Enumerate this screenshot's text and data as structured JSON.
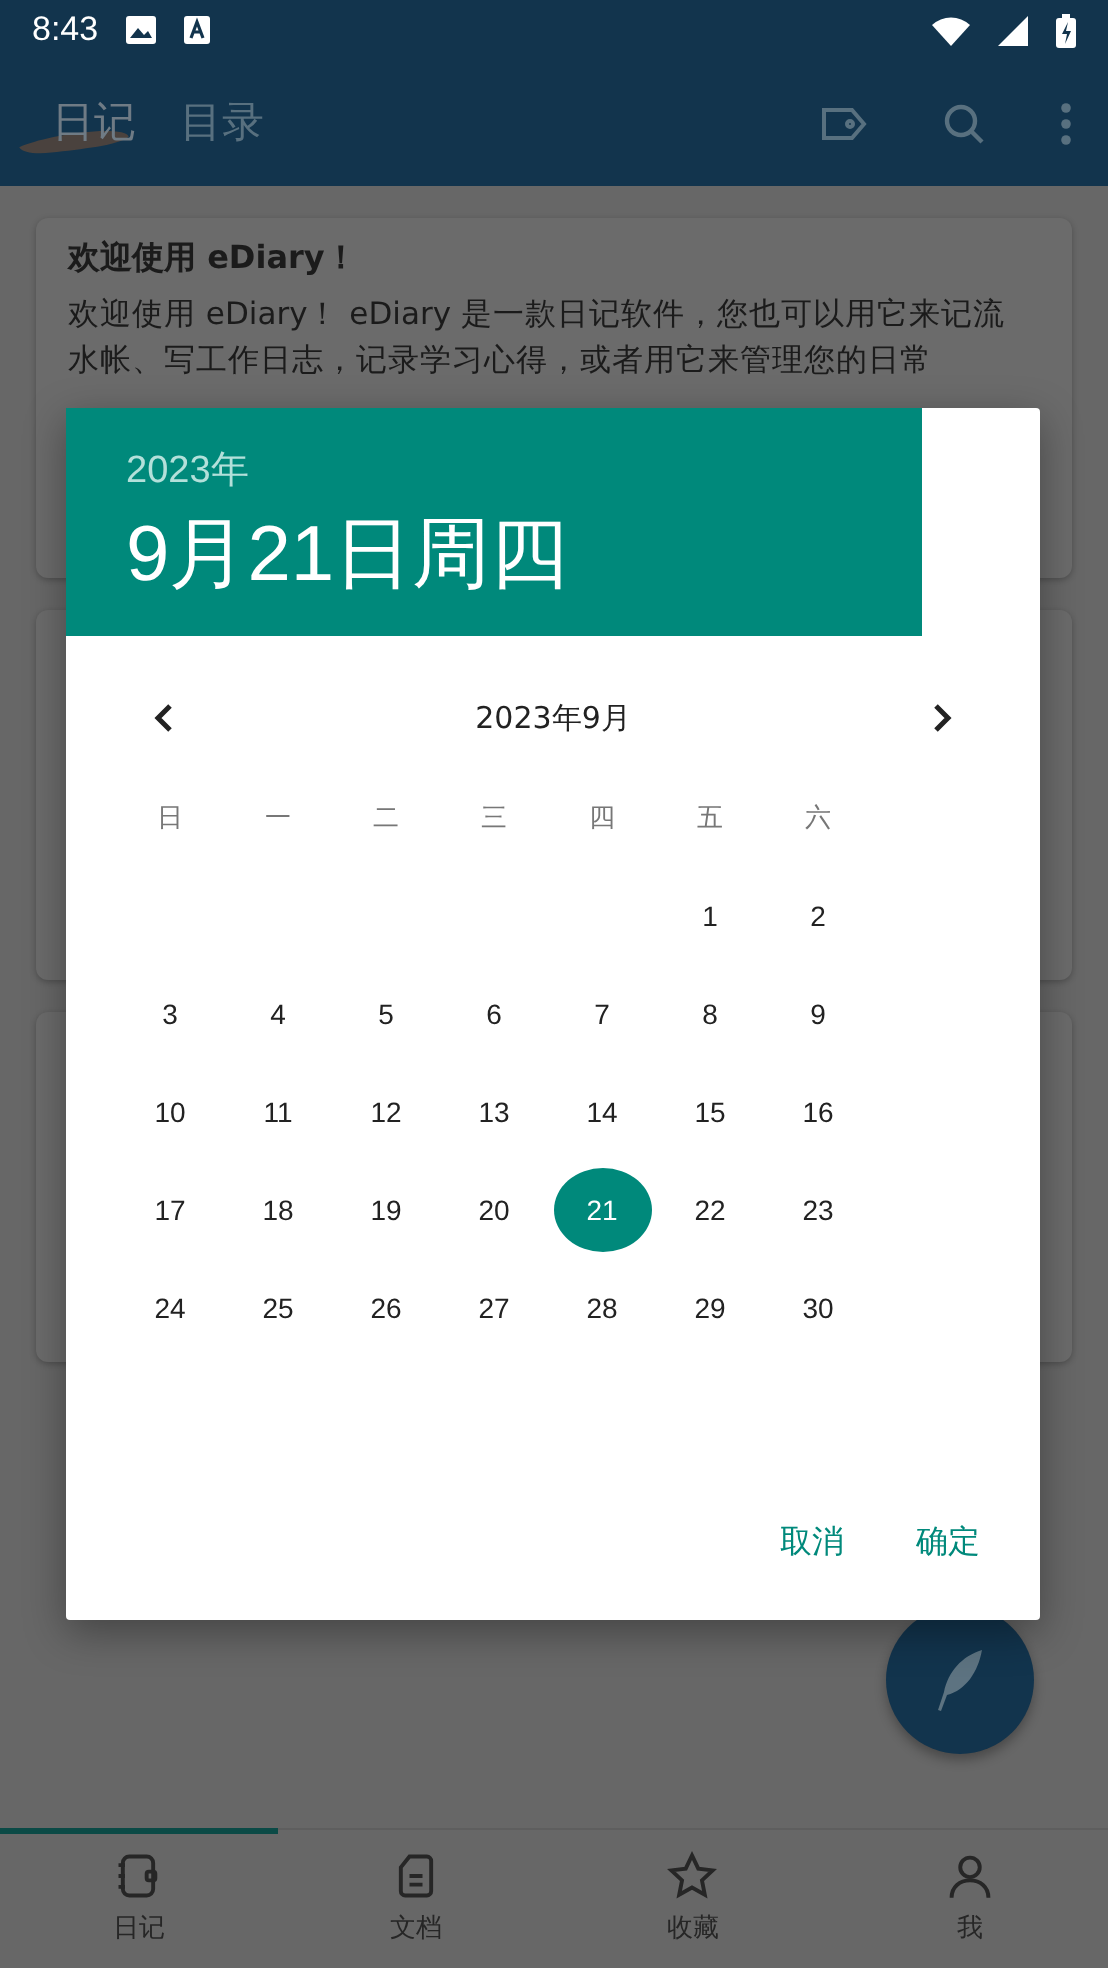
{
  "status_bar": {
    "time": "8:43"
  },
  "app_bar": {
    "tabs": [
      {
        "label": "日记",
        "selected": true
      },
      {
        "label": "目录",
        "selected": false
      }
    ]
  },
  "cards": [
    {
      "title": "欢迎使用 eDiary！",
      "body": "欢迎使用 eDiary！ eDiary 是一款日记软件，您也可以用它来记流水帐、写工作日志，记录学习心得，或者用它来管理您的日常"
    }
  ],
  "date_picker": {
    "year": "2023年",
    "date": "9月21日周四",
    "month": "2023年9月",
    "weekdays": [
      "日",
      "一",
      "二",
      "三",
      "四",
      "五",
      "六"
    ],
    "weeks": [
      {
        "days": [
          {
            "day": "1",
            "selected": false
          },
          {
            "day": "2",
            "selected": false
          }
        ]
      },
      {
        "days": [
          {
            "day": "3",
            "selected": false
          },
          {
            "day": "4",
            "selected": false
          },
          {
            "day": "5",
            "selected": false
          },
          {
            "day": "6",
            "selected": false
          },
          {
            "day": "7",
            "selected": false
          },
          {
            "day": "8",
            "selected": false
          },
          {
            "day": "9",
            "selected": false
          }
        ]
      },
      {
        "days": [
          {
            "day": "10",
            "selected": false
          },
          {
            "day": "11",
            "selected": false
          },
          {
            "day": "12",
            "selected": false
          },
          {
            "day": "13",
            "selected": false
          },
          {
            "day": "14",
            "selected": false
          },
          {
            "day": "15",
            "selected": false
          },
          {
            "day": "16",
            "selected": false
          }
        ]
      },
      {
        "days": [
          {
            "day": "17",
            "selected": false
          },
          {
            "day": "18",
            "selected": false
          },
          {
            "day": "19",
            "selected": false
          },
          {
            "day": "20",
            "selected": false
          },
          {
            "day": "21",
            "selected": true
          },
          {
            "day": "22",
            "selected": false
          },
          {
            "day": "23",
            "selected": false
          }
        ]
      },
      {
        "days": [
          {
            "day": "24",
            "selected": false
          },
          {
            "day": "25",
            "selected": false
          },
          {
            "day": "26",
            "selected": false
          },
          {
            "day": "27",
            "selected": false
          },
          {
            "day": "28",
            "selected": false
          },
          {
            "day": "29",
            "selected": false
          },
          {
            "day": "30",
            "selected": false
          }
        ]
      }
    ],
    "buttons": [
      "取消",
      "确定"
    ]
  },
  "bottom_nav": [
    {
      "label": "日记",
      "kind": "diary",
      "selected": true
    },
    {
      "label": "文档",
      "kind": "docs",
      "selected": false
    },
    {
      "label": "收藏",
      "kind": "star",
      "selected": false
    },
    {
      "label": "我",
      "kind": "user",
      "selected": false
    }
  ]
}
